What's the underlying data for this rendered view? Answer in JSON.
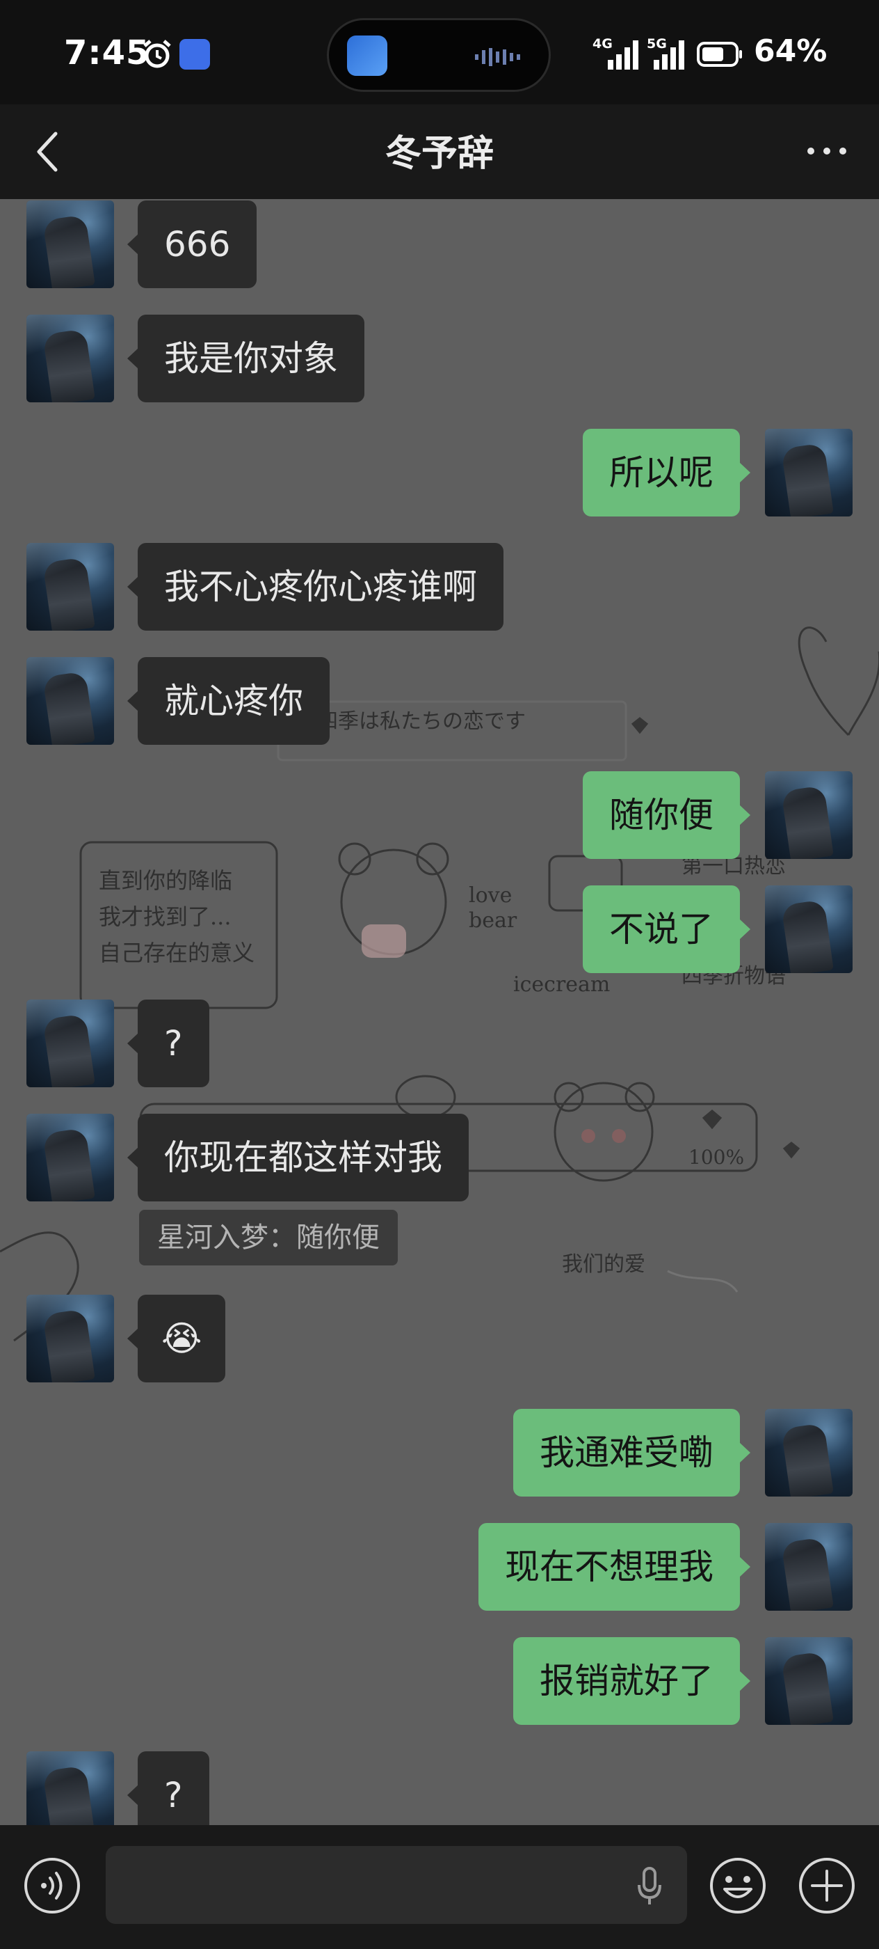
{
  "status_bar": {
    "time": "7:45",
    "network_1": "4G",
    "network_2": "5G",
    "battery_percent": "64%",
    "icons": [
      "alarm-icon",
      "app-notification-icon",
      "signal-icon",
      "battery-icon"
    ]
  },
  "header": {
    "title": "冬予辞",
    "icons": [
      "back-icon",
      "more-icon"
    ]
  },
  "messages": [
    {
      "side": "left",
      "text": "666"
    },
    {
      "side": "left",
      "text": "我是你对象"
    },
    {
      "side": "right",
      "text": "所以呢"
    },
    {
      "side": "left",
      "text": "我不心疼你心疼谁啊"
    },
    {
      "side": "left",
      "text": "就心疼你"
    },
    {
      "side": "right",
      "text": "随你便"
    },
    {
      "side": "right",
      "text": "不说了"
    },
    {
      "side": "left",
      "text": "?"
    },
    {
      "side": "left",
      "text": "你现在都这样对我",
      "quote": "星河入梦：随你便"
    },
    {
      "side": "left",
      "text": "😭"
    },
    {
      "side": "right",
      "text": "我通难受嘞"
    },
    {
      "side": "right",
      "text": "现在不想理我"
    },
    {
      "side": "right",
      "text": "报销就好了"
    },
    {
      "side": "left",
      "text": "?"
    }
  ],
  "wallpaper": {
    "texts": {
      "phrase": "四季は私たちの恋です",
      "note_lines": [
        "直到你的降临",
        "我才找到了...",
        "自己存在的意义"
      ],
      "love_bear_1": "love",
      "love_bear_2": "bear",
      "icecream": "icecream",
      "right_note": [
        "第一口热恋",
        "...",
        "四季折物语"
      ],
      "percent": "100%",
      "our_love": "我们的爱"
    }
  },
  "input_bar": {
    "icons": [
      "voice-mode-icon",
      "microphone-icon",
      "emoji-icon",
      "plus-icon"
    ]
  },
  "colors": {
    "bubble_right": "#6bbd7b",
    "bubble_left": "#2b2b2b",
    "chat_background": "#5f5f5f",
    "bars": "#191919"
  }
}
